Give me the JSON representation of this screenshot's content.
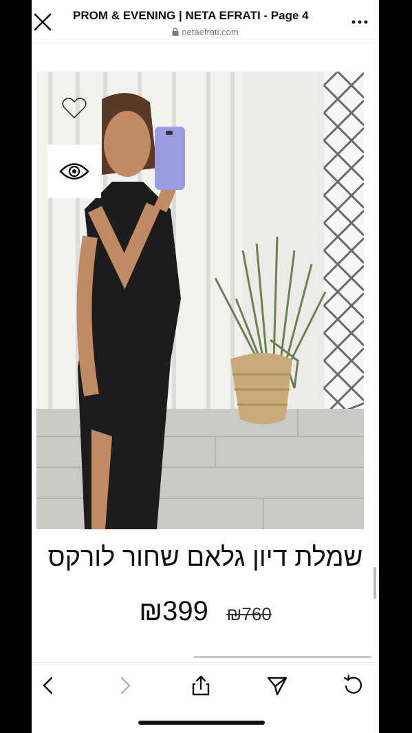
{
  "header": {
    "title": "PROM & EVENING | NETA EFRATI - Page 4",
    "url": "netaefrati.com"
  },
  "product": {
    "name": "שמלת דיון גלאם שחור לורקס",
    "price": "₪399",
    "old_price": "₪760"
  },
  "icons": [
    "close-icon",
    "lock-icon",
    "more-icon",
    "heart-icon",
    "eye-icon",
    "back-icon",
    "forward-icon",
    "share-icon",
    "send-icon",
    "refresh-icon"
  ]
}
